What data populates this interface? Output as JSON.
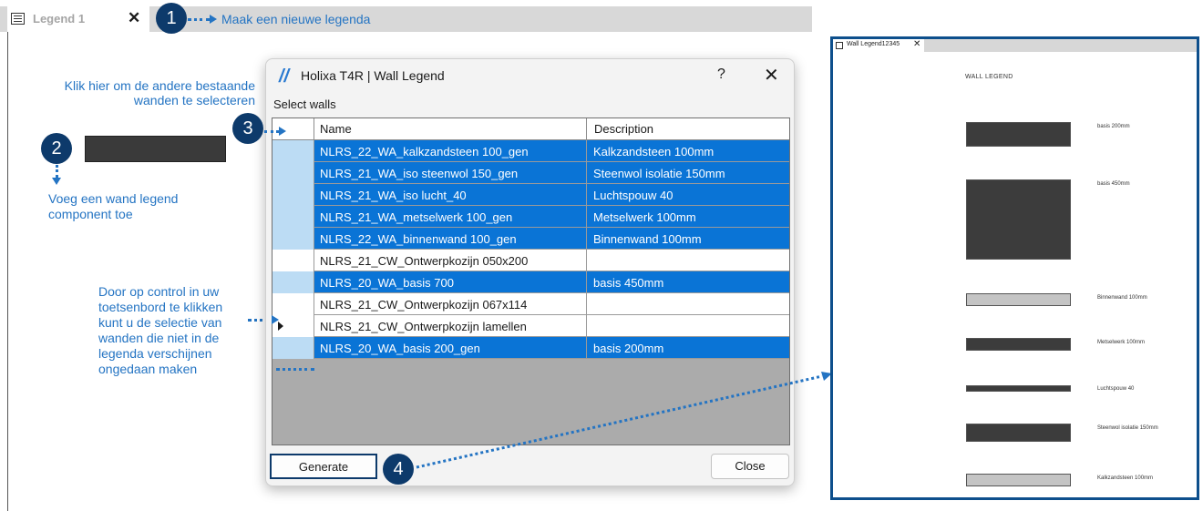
{
  "tab": {
    "label": "Legend 1",
    "close": "✕",
    "icon": "legend-icon"
  },
  "annotations": {
    "step1": {
      "badge": "1",
      "text": "Maak een nieuwe legenda"
    },
    "step2": {
      "badge": "2",
      "text_line1": "Voeg een wand legend",
      "text_line2": "component toe"
    },
    "step3": {
      "badge": "3"
    },
    "step4": {
      "badge": "4"
    },
    "click_here_line1": "Klik hier om de andere bestaande",
    "click_here_line2": "wanden te selecteren",
    "control_lines": [
      "Door op control in uw",
      "toetsenbord te klikken",
      "kunt u de selectie van",
      "wanden die niet in de",
      "legenda verschijnen",
      "ongedaan maken"
    ]
  },
  "dialog": {
    "logo": "//",
    "title": "Holixa T4R | Wall Legend",
    "help": "?",
    "close": "✕",
    "subtitle": "Select walls",
    "columns": {
      "name": "Name",
      "description": "Description"
    },
    "rows": [
      {
        "name": "NLRS_22_WA_kalkzandsteen 100_gen",
        "description": "Kalkzandsteen 100mm",
        "selected": true
      },
      {
        "name": "NLRS_21_WA_iso steenwol 150_gen",
        "description": "Steenwol isolatie 150mm",
        "selected": true
      },
      {
        "name": "NLRS_21_WA_iso lucht_40",
        "description": "Luchtspouw 40",
        "selected": true
      },
      {
        "name": "NLRS_21_WA_metselwerk 100_gen",
        "description": "Metselwerk 100mm",
        "selected": true
      },
      {
        "name": "NLRS_22_WA_binnenwand 100_gen",
        "description": "Binnenwand 100mm",
        "selected": true
      },
      {
        "name": "NLRS_21_CW_Ontwerpkozijn 050x200",
        "description": "",
        "selected": false
      },
      {
        "name": "NLRS_20_WA_basis 700",
        "description": "basis 450mm",
        "selected": true
      },
      {
        "name": "NLRS_21_CW_Ontwerpkozijn 067x114",
        "description": "",
        "selected": false
      },
      {
        "name": "NLRS_21_CW_Ontwerpkozijn lamellen",
        "description": "",
        "selected": false
      },
      {
        "name": "NLRS_20_WA_basis 200_gen",
        "description": "basis 200mm",
        "selected": true
      }
    ],
    "generate_label": "Generate",
    "close_label": "Close"
  },
  "preview": {
    "tab_label": "Wall Legend12345",
    "tab_close": "✕",
    "title": "WALL LEGEND",
    "items": [
      {
        "label": "basis 200mm",
        "color": "#3c3c3c"
      },
      {
        "label": "basis 450mm",
        "color": "#3c3c3c"
      },
      {
        "label": "Binnenwand 100mm",
        "color": "#c4c4c4"
      },
      {
        "label": "Metselwerk 100mm",
        "color": "#3c3c3c"
      },
      {
        "label": "Luchtspouw 40",
        "color": "#3c3c3c"
      },
      {
        "label": "Steenwol isolatie 150mm",
        "color": "#3c3c3c"
      },
      {
        "label": "Kalkzandsteen 100mm",
        "color": "#c4c4c4"
      }
    ]
  },
  "colors": {
    "accent": "#0a74d6",
    "badge": "#0d3a6b",
    "annotation": "#2474c3"
  }
}
